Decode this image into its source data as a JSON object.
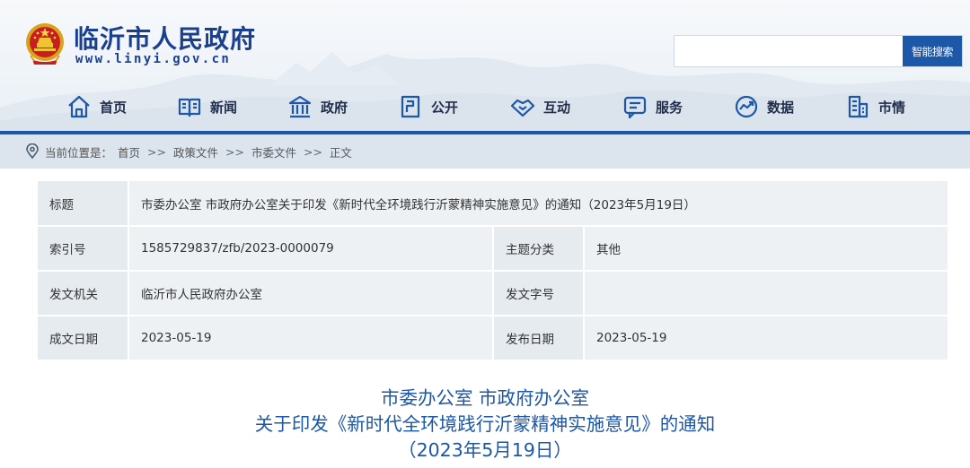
{
  "header": {
    "title": "临沂市人民政府",
    "url": "www.linyi.gov.cn",
    "search": {
      "placeholder": "",
      "button_label": "智能搜索"
    }
  },
  "nav": {
    "items": [
      {
        "label": "首页",
        "icon": "home-icon"
      },
      {
        "label": "新闻",
        "icon": "news-icon"
      },
      {
        "label": "政府",
        "icon": "government-icon"
      },
      {
        "label": "公开",
        "icon": "disclosure-icon"
      },
      {
        "label": "互动",
        "icon": "handshake-icon"
      },
      {
        "label": "服务",
        "icon": "service-icon"
      },
      {
        "label": "数据",
        "icon": "data-icon"
      },
      {
        "label": "市情",
        "icon": "city-icon"
      }
    ],
    "accent": "#1d57a7"
  },
  "breadcrumb": {
    "prefix": "当前位置是：",
    "items": [
      "首页",
      "政策文件",
      "市委文件",
      "正文"
    ],
    "separator": ">>"
  },
  "meta": {
    "title_label": "标题",
    "title_value": "市委办公室 市政府办公室关于印发《新时代全环境践行沂蒙精神实施意见》的通知（2023年5月19日）",
    "index_label": "索引号",
    "index_value": "1585729837/zfb/2023-0000079",
    "topic_label": "主题分类",
    "topic_value": "其他",
    "issuer_label": "发文机关",
    "issuer_value": "临沂市人民政府办公室",
    "docno_label": "发文字号",
    "docno_value": "",
    "created_label": "成文日期",
    "created_value": "2023-05-19",
    "published_label": "发布日期",
    "published_value": "2023-05-19"
  },
  "doc": {
    "title_line1": "市委办公室 市政府办公室",
    "title_line2": "关于印发《新时代全环境践行沂蒙精神实施意见》的通知",
    "title_line3": "（2023年5月19日）"
  }
}
